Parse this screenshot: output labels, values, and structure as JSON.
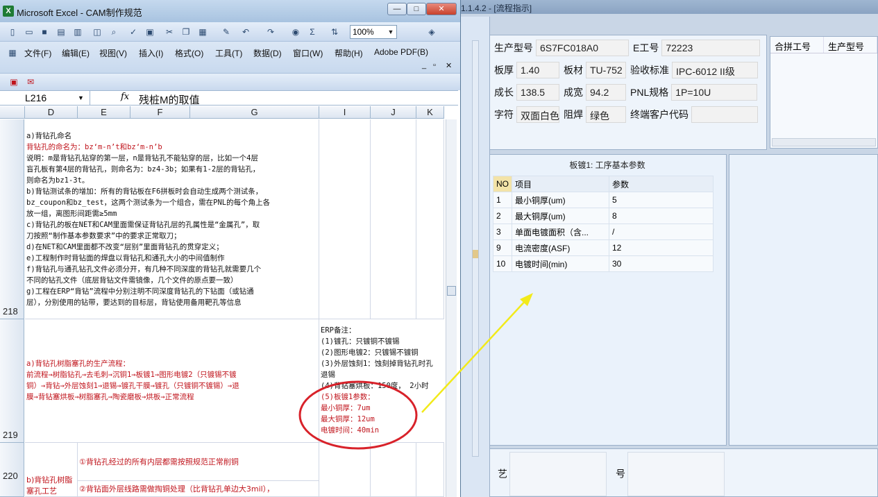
{
  "excel": {
    "title": "Microsoft Excel - CAM制作规范",
    "icon": "X",
    "zoom": "100%",
    "menus": [
      "文件(F)",
      "编辑(E)",
      "视图(V)",
      "插入(I)",
      "格式(O)",
      "工具(T)",
      "数据(D)",
      "窗口(W)",
      "帮助(H)",
      "Adobe PDF(B)"
    ],
    "namebox": "L216",
    "fx": "fx",
    "formula": "残桩M的取值",
    "columns": [
      "D",
      "E",
      "F",
      "G",
      "I",
      "J",
      "K"
    ],
    "rows": {
      "r218": {
        "num": "218",
        "lines": [
          {
            "t": "a)背钻孔命名",
            "c": "black"
          },
          {
            "t": "背钻孔的命名为：bz‘m-n’t和bz‘m-n’b",
            "c": "red"
          },
          {
            "t": "说明：m是背钻孔钻穿的第一层，n是背钻孔不能钻穿的层，比如一个4层",
            "c": "black"
          },
          {
            "t": "盲孔板有第4层的背钻孔，则命名为：bz4-3b；如果有1-2层的背钻孔，",
            "c": "black"
          },
          {
            "t": "则命名为bz1-3t。",
            "c": "black"
          },
          {
            "t": "b)背钻测试条的增加：所有的背钻板在F6拼板时会自动生成两个测试条，",
            "c": "black"
          },
          {
            "t": "bz_coupon和bz_test，这两个测试条为一个组合，需在PNL的每个角上各",
            "c": "black"
          },
          {
            "t": "放一组，离图形间距需≥5mm",
            "c": "black"
          },
          {
            "t": "c)背钻孔的板在NET和CAM里面需保证背钻孔层的孔属性是“金属孔”，取",
            "c": "black"
          },
          {
            "t": "刀按照“制作基本参数要求”中的要求正常取刀；",
            "c": "black"
          },
          {
            "t": "d)在NET和CAM里面都不改变“层别”里面背钻孔的贯穿定义；",
            "c": "black"
          },
          {
            "t": "e)工程制作时背钻面的焊盘以背钻孔和通孔大小的中间值制作",
            "c": "black"
          },
          {
            "t": "f)背钻孔与通孔钻孔文件必须分开，有几种不同深度的背钻孔就需要几个",
            "c": "black"
          },
          {
            "t": "不同的钻孔文件（底层背钻文件需镜像，几个文件的原点要一致）",
            "c": "black"
          },
          {
            "t": "g)工程在ERP“背钻”流程中分别注明不同深度背钻孔的下钻面（或钻通",
            "c": "black"
          },
          {
            "t": "层），分别使用的钻带，要达到的目标层，背钻使用备用靶孔等信息",
            "c": "black"
          }
        ]
      },
      "r219": {
        "num": "219",
        "lines": [
          {
            "t": "a)背钻孔树脂塞孔的生产流程：",
            "c": "red"
          },
          {
            "t": "前流程→树脂钻孔→去毛刺→沉铜1→板镀1→图形电镀2（只镀锡不镀",
            "c": "red"
          },
          {
            "t": "铜）→背钻→外层蚀刻1→退锡→镀孔干膜→镀孔（只镀铜不镀锡）→退",
            "c": "red"
          },
          {
            "t": "膜→背钻塞烘板→树脂塞孔→陶瓷磨板→烘板→正常流程",
            "c": "red"
          }
        ],
        "erp": [
          {
            "t": "ERP备注：",
            "c": "black"
          },
          {
            "t": "(1)镀孔：只镀铜不镀锡",
            "c": "black"
          },
          {
            "t": "(2)图形电镀2：只镀锡不镀铜",
            "c": "black"
          },
          {
            "t": "(3)外层蚀刻1：蚀刻掉背钻孔时孔",
            "c": "black"
          },
          {
            "t": "退锡",
            "c": "black"
          },
          {
            "t": "(4)背钻塞烘板：150度， 2小时",
            "c": "black"
          },
          {
            "t": "(5)板镀1参数：",
            "c": "red"
          },
          {
            "t": "最小铜厚：7um",
            "c": "red"
          },
          {
            "t": "最大铜厚：12um",
            "c": "red"
          },
          {
            "t": "电镀时间：40min",
            "c": "red"
          }
        ]
      },
      "r220": {
        "num": "220",
        "d_label": "b)背钻孔树脂塞孔工艺",
        "line1": "①背钻孔经过的所有内层都需按照规范正常削铜",
        "line2": "②背钻面外层线路需做掏铜处理（比背钻孔单边大3mil），"
      }
    }
  },
  "app": {
    "title": "1.1.4.2 - [流程指示]",
    "fields": {
      "model_label": "生产型号",
      "model_value": "6S7FC018A0",
      "eno_label": "E工号",
      "eno_value": "72223",
      "thick_label": "板厚",
      "thick_value": "1.40",
      "mat_label": "板材",
      "mat_value": "TU-752",
      "std_label": "验收标准",
      "std_value": "IPC-6012 II级",
      "len_label": "成长",
      "len_value": "138.5",
      "wid_label": "成宽",
      "wid_value": "94.2",
      "pnl_label": "PNL规格",
      "pnl_value": "1P=10U",
      "char_label": "字符",
      "char_value": "双面白色",
      "mask_label": "阻焊",
      "mask_value": "绿色",
      "cust_label": "终端客户代码",
      "cust_value": ""
    },
    "list_headers": [
      "合拼工号",
      "生产型号"
    ],
    "params_caption": "板镀1: 工序基本参数",
    "params_header": {
      "no": "NO",
      "item": "项目",
      "val": "参数"
    },
    "params": [
      {
        "no": "1",
        "item": "最小铜厚(um)",
        "val": "5"
      },
      {
        "no": "2",
        "item": "最大铜厚(um)",
        "val": "8"
      },
      {
        "no": "3",
        "item": "单面电镀面积（含...",
        "val": "/"
      },
      {
        "no": "9",
        "item": "电流密度(ASF)",
        "val": "12"
      },
      {
        "no": "10",
        "item": "电镀时间(min)",
        "val": "30"
      }
    ],
    "bottom_labels": {
      "craft": "工艺",
      "model": "型号"
    }
  },
  "colors": {
    "red_text": "#c0141c",
    "annotation_red": "#d8222a",
    "arrow_yellow": "#f2ea1a"
  }
}
